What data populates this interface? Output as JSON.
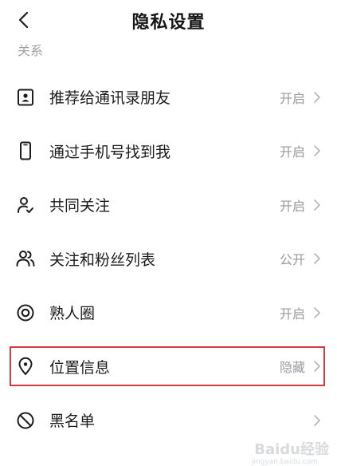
{
  "header": {
    "title": "隐私设置",
    "back_icon": "chevron-left-icon"
  },
  "section": {
    "title": "关系"
  },
  "items": [
    {
      "label": "推荐给通讯录朋友",
      "value": "开启",
      "icon": "contact-card-icon"
    },
    {
      "label": "通过手机号找到我",
      "value": "开启",
      "icon": "phone-icon"
    },
    {
      "label": "共同关注",
      "value": "开启",
      "icon": "user-check-icon"
    },
    {
      "label": "关注和粉丝列表",
      "value": "公开",
      "icon": "users-icon"
    },
    {
      "label": "熟人圈",
      "value": "开启",
      "icon": "circle-target-icon"
    },
    {
      "label": "位置信息",
      "value": "隐藏",
      "icon": "location-pin-icon"
    },
    {
      "label": "黑名单",
      "value": "",
      "icon": "block-icon"
    }
  ],
  "highlight": {
    "target": "位置信息",
    "color": "#d6393f"
  },
  "watermark": {
    "text": "Baidu经验",
    "sub": "jingyan.baidu.com"
  }
}
